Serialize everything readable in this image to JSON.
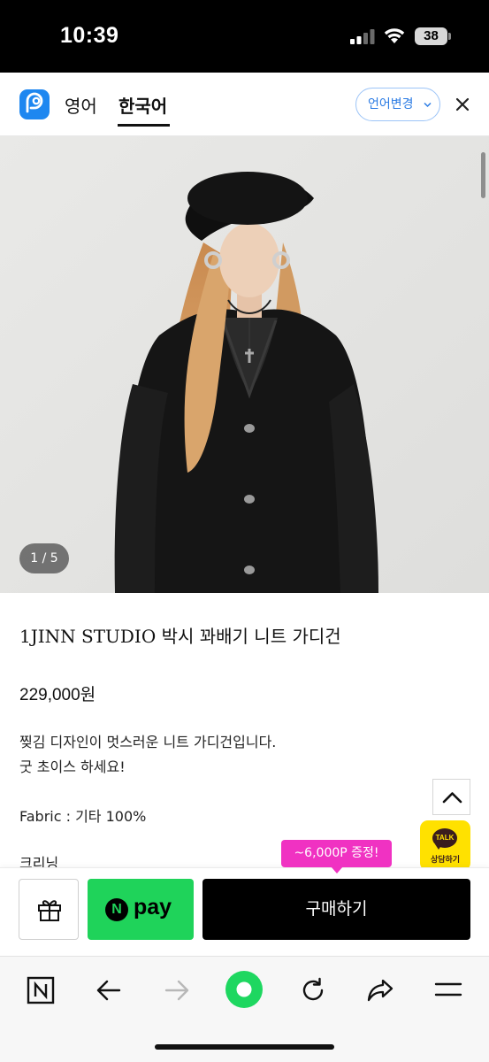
{
  "status_bar": {
    "time": "10:39",
    "battery": "38"
  },
  "language_bar": {
    "tabs": [
      {
        "label": "영어"
      },
      {
        "label": "한국어"
      }
    ],
    "change_language_label": "언어변경"
  },
  "product": {
    "image_counter": "1 / 5",
    "title": "1JINN STUDIO 박시 꽈배기 니트 가디건",
    "price": "229,000원",
    "description_lines": [
      "찢김 디자인이 멋스러운 니트 가디건입니다.",
      "굿 초이스 하세요!",
      "Fabric : 기타 100%",
      "크리닝"
    ]
  },
  "floating": {
    "talk_badge": "TALK",
    "talk_label": "상담하기"
  },
  "purchase_bar": {
    "promo": "~6,000P 증정!",
    "npay_n": "N",
    "npay_label": "pay",
    "buy_label": "구매하기"
  },
  "browser_nav": {
    "icons": [
      "naver-n-icon",
      "back-arrow-icon",
      "forward-arrow-icon",
      "green-home-icon",
      "refresh-icon",
      "share-icon",
      "menu-icon"
    ]
  },
  "colors": {
    "accent_blue": "#2a7be4",
    "npay_green": "#1fd35a",
    "promo_pink": "#f032c2",
    "kakao_yellow": "#ffe100",
    "naver_green": "#1ed760"
  }
}
